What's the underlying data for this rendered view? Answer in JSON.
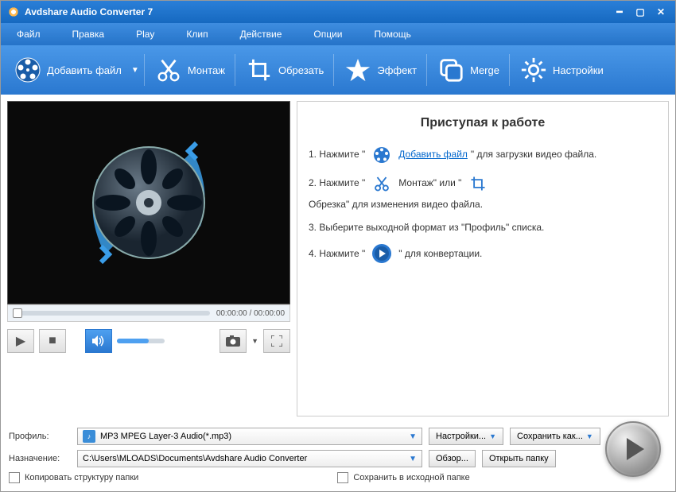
{
  "title": "Avdshare Audio Converter 7",
  "menu": [
    "Файл",
    "Правка",
    "Play",
    "Клип",
    "Действие",
    "Опции",
    "Помощь"
  ],
  "toolbar": [
    {
      "icon": "reel",
      "label": "Добавить файл",
      "dropdown": true
    },
    {
      "icon": "scissors",
      "label": "Монтаж"
    },
    {
      "icon": "crop",
      "label": "Обрезать"
    },
    {
      "icon": "star",
      "label": "Эффект"
    },
    {
      "icon": "merge",
      "label": "Merge"
    },
    {
      "icon": "gear",
      "label": "Настройки"
    }
  ],
  "time": "00:00:00 / 00:00:00",
  "gs": {
    "title": "Приступая к работе",
    "step1_a": "1. Нажмите \"",
    "step1_link": "Добавить файл",
    "step1_b": "\" для загрузки видео файла.",
    "step2": "2. Нажмите \"",
    "step2_montage": "Монтаж\" или \"",
    "step2_crop": "Обрезка\" для изменения видео файла.",
    "step3": "3. Выберите выходной формат из \"Профиль\" списка.",
    "step4_a": "4. Нажмите \"",
    "step4_b": "\" для конвертации."
  },
  "profile": {
    "label": "Профиль:",
    "value": "MP3 MPEG Layer-3 Audio(*.mp3)",
    "settings_btn": "Настройки...",
    "saveas_btn": "Сохранить как..."
  },
  "dest": {
    "label": "Назначение:",
    "value": "C:\\Users\\MLOADS\\Documents\\Avdshare Audio Converter",
    "browse_btn": "Обзор...",
    "open_btn": "Открыть папку"
  },
  "checks": {
    "copy": "Копировать структуру папки",
    "save_src": "Сохранить в исходной папке"
  }
}
